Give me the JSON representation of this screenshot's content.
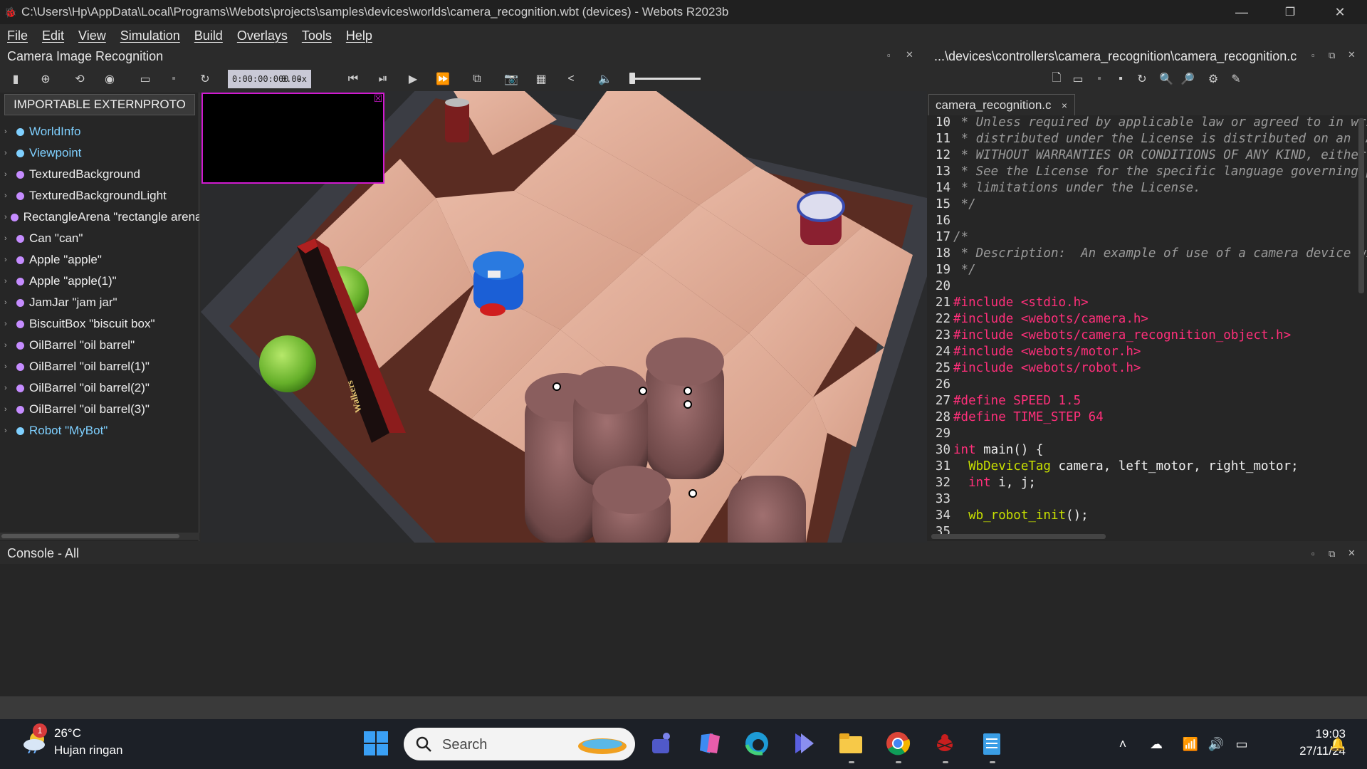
{
  "window": {
    "title": "C:\\Users\\Hp\\AppData\\Local\\Programs\\Webots\\projects\\samples\\devices\\worlds\\camera_recognition.wbt (devices) - Webots R2023b",
    "minimize": "—",
    "restore": "❐",
    "close": "✕"
  },
  "menu": [
    "File",
    "Edit",
    "View",
    "Simulation",
    "Build",
    "Overlays",
    "Tools",
    "Help"
  ],
  "left_panel": {
    "title": "Camera Image Recognition",
    "sim_time": "0:00:00:000",
    "speed": "0.00x",
    "speed_dash": "-",
    "extern_button": "IMPORTABLE EXTERNPROTO",
    "nodes": [
      {
        "label": "WorldInfo",
        "color": "blue"
      },
      {
        "label": "Viewpoint",
        "color": "blue"
      },
      {
        "label": "TexturedBackground",
        "color": "white"
      },
      {
        "label": "TexturedBackgroundLight",
        "color": "white"
      },
      {
        "label": "RectangleArena \"rectangle arena\"",
        "color": "white"
      },
      {
        "label": "Can \"can\"",
        "color": "white"
      },
      {
        "label": "Apple \"apple\"",
        "color": "white"
      },
      {
        "label": "Apple \"apple(1)\"",
        "color": "white"
      },
      {
        "label": "JamJar \"jam jar\"",
        "color": "white"
      },
      {
        "label": "BiscuitBox \"biscuit box\"",
        "color": "white"
      },
      {
        "label": "OilBarrel \"oil barrel\"",
        "color": "white"
      },
      {
        "label": "OilBarrel \"oil barrel(1)\"",
        "color": "white"
      },
      {
        "label": "OilBarrel \"oil barrel(2)\"",
        "color": "white"
      },
      {
        "label": "OilBarrel \"oil barrel(3)\"",
        "color": "white"
      },
      {
        "label": "Robot \"MyBot\"",
        "color": "blue"
      }
    ],
    "biscuit_text": "Walkers"
  },
  "editor": {
    "title": "...\\devices\\controllers\\camera_recognition\\camera_recognition.c",
    "tab_label": "camera_recognition.c",
    "tab_close": "×",
    "lines": [
      {
        "n": "10",
        "parts": [
          {
            "c": "cm",
            "t": " * Unless required by applicable law or agreed to in writing, software"
          }
        ]
      },
      {
        "n": "11",
        "parts": [
          {
            "c": "cm",
            "t": " * distributed under the License is distributed on an \"AS IS\" BASIS,"
          }
        ]
      },
      {
        "n": "12",
        "parts": [
          {
            "c": "cm",
            "t": " * WITHOUT WARRANTIES OR CONDITIONS OF ANY KIND, either express or implied."
          }
        ]
      },
      {
        "n": "13",
        "parts": [
          {
            "c": "cm",
            "t": " * See the License for the specific language governing permissions and"
          }
        ]
      },
      {
        "n": "14",
        "parts": [
          {
            "c": "cm",
            "t": " * limitations under the License."
          }
        ]
      },
      {
        "n": "15",
        "parts": [
          {
            "c": "cm",
            "t": " */"
          }
        ]
      },
      {
        "n": "16",
        "parts": []
      },
      {
        "n": "17",
        "parts": [
          {
            "c": "cm",
            "t": "/*"
          }
        ]
      },
      {
        "n": "18",
        "parts": [
          {
            "c": "cm",
            "t": " * Description:  An example of use of a camera device with recognition capability."
          }
        ]
      },
      {
        "n": "19",
        "parts": [
          {
            "c": "cm",
            "t": " */"
          }
        ]
      },
      {
        "n": "20",
        "parts": []
      },
      {
        "n": "21",
        "parts": [
          {
            "c": "pp",
            "t": "#include <stdio.h>"
          }
        ]
      },
      {
        "n": "22",
        "parts": [
          {
            "c": "pp",
            "t": "#include <webots/camera.h>"
          }
        ]
      },
      {
        "n": "23",
        "parts": [
          {
            "c": "pp",
            "t": "#include <webots/camera_recognition_object.h>"
          }
        ]
      },
      {
        "n": "24",
        "parts": [
          {
            "c": "pp",
            "t": "#include <webots/motor.h>"
          }
        ]
      },
      {
        "n": "25",
        "parts": [
          {
            "c": "pp",
            "t": "#include <webots/robot.h>"
          }
        ]
      },
      {
        "n": "26",
        "parts": []
      },
      {
        "n": "27",
        "parts": [
          {
            "c": "pp",
            "t": "#define SPEED 1.5"
          }
        ]
      },
      {
        "n": "28",
        "parts": [
          {
            "c": "pp",
            "t": "#define TIME_STEP 64"
          }
        ]
      },
      {
        "n": "29",
        "parts": []
      },
      {
        "n": "30",
        "parts": [
          {
            "c": "kw",
            "t": "int"
          },
          {
            "c": "tx",
            "t": " main() {"
          }
        ]
      },
      {
        "n": "31",
        "parts": [
          {
            "c": "tp",
            "t": "  WbDeviceTag"
          },
          {
            "c": "tx",
            "t": " camera, left_motor, right_motor;"
          }
        ]
      },
      {
        "n": "32",
        "parts": [
          {
            "c": "kw",
            "t": "  int"
          },
          {
            "c": "tx",
            "t": " i, j;"
          }
        ]
      },
      {
        "n": "33",
        "parts": []
      },
      {
        "n": "34",
        "parts": [
          {
            "c": "tp",
            "t": "  wb_robot_init"
          },
          {
            "c": "tx",
            "t": "();"
          }
        ]
      },
      {
        "n": "35",
        "parts": []
      }
    ]
  },
  "console": {
    "title": "Console - All"
  },
  "taskbar": {
    "badge": "1",
    "temperature": "26°C",
    "condition": "Hujan ringan",
    "search": "Search",
    "time": "19:03",
    "date": "27/11/24"
  },
  "colors": {
    "accent": "#d01ad0",
    "node_blue": "#7fd0ff",
    "keyword": "#ff2f7a",
    "type": "#c8e000"
  }
}
